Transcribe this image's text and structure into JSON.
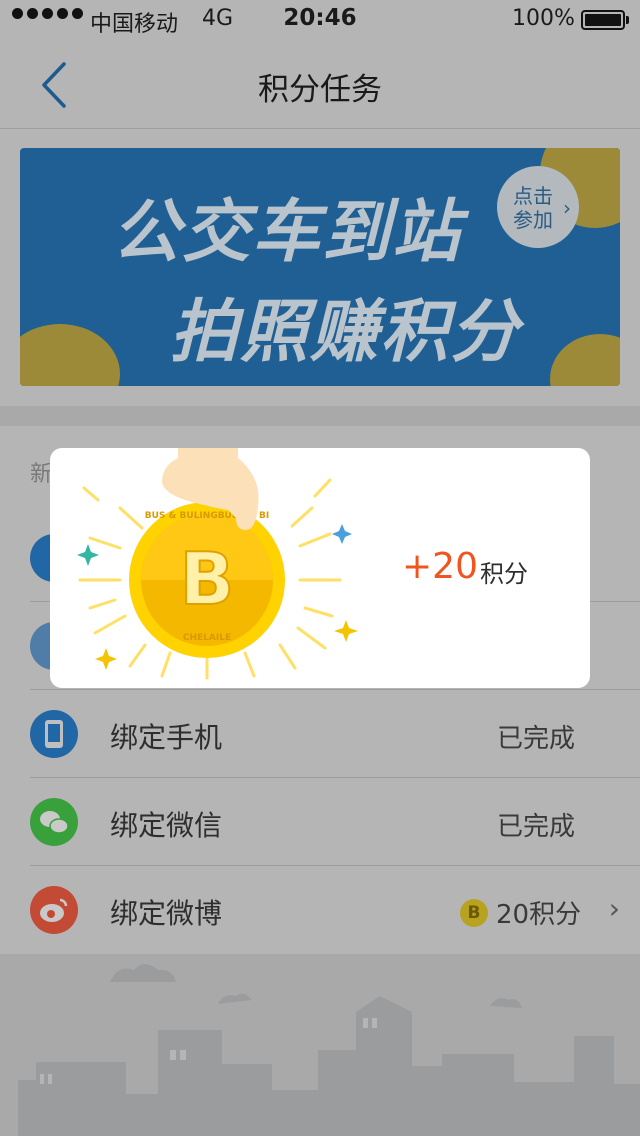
{
  "status_bar": {
    "carrier": "中国移动",
    "network": "4G",
    "time": "20:46",
    "battery": "100%"
  },
  "nav": {
    "title": "积分任务",
    "back_icon": "chevron-left-icon"
  },
  "banner": {
    "line1": "公交车到站",
    "line2": "拍照赚积分",
    "cta_line1": "点击",
    "cta_line2": "参加",
    "cta_arrow": "›",
    "background": "#1f5f94"
  },
  "section": {
    "header_partial": "新"
  },
  "popup": {
    "points": "+20",
    "points_label": "积分",
    "coin_letter": "B",
    "coin_ring_top": "BUS & BULINGBULING BI",
    "coin_ring_bottom": "CHELAILE",
    "accent": "#f0541f"
  },
  "rows": [
    {
      "label": "绑定手机",
      "status": "已完成",
      "icon": "phone-icon",
      "icon_color": "#2167a6"
    },
    {
      "label": "绑定微信",
      "status": "已完成",
      "icon": "wechat-icon",
      "icon_color": "#38a13b"
    },
    {
      "label": "绑定微博",
      "points": "20积分",
      "coin": "B",
      "icon": "weibo-icon",
      "icon_color": "#c34a35",
      "chevron": "›"
    }
  ]
}
